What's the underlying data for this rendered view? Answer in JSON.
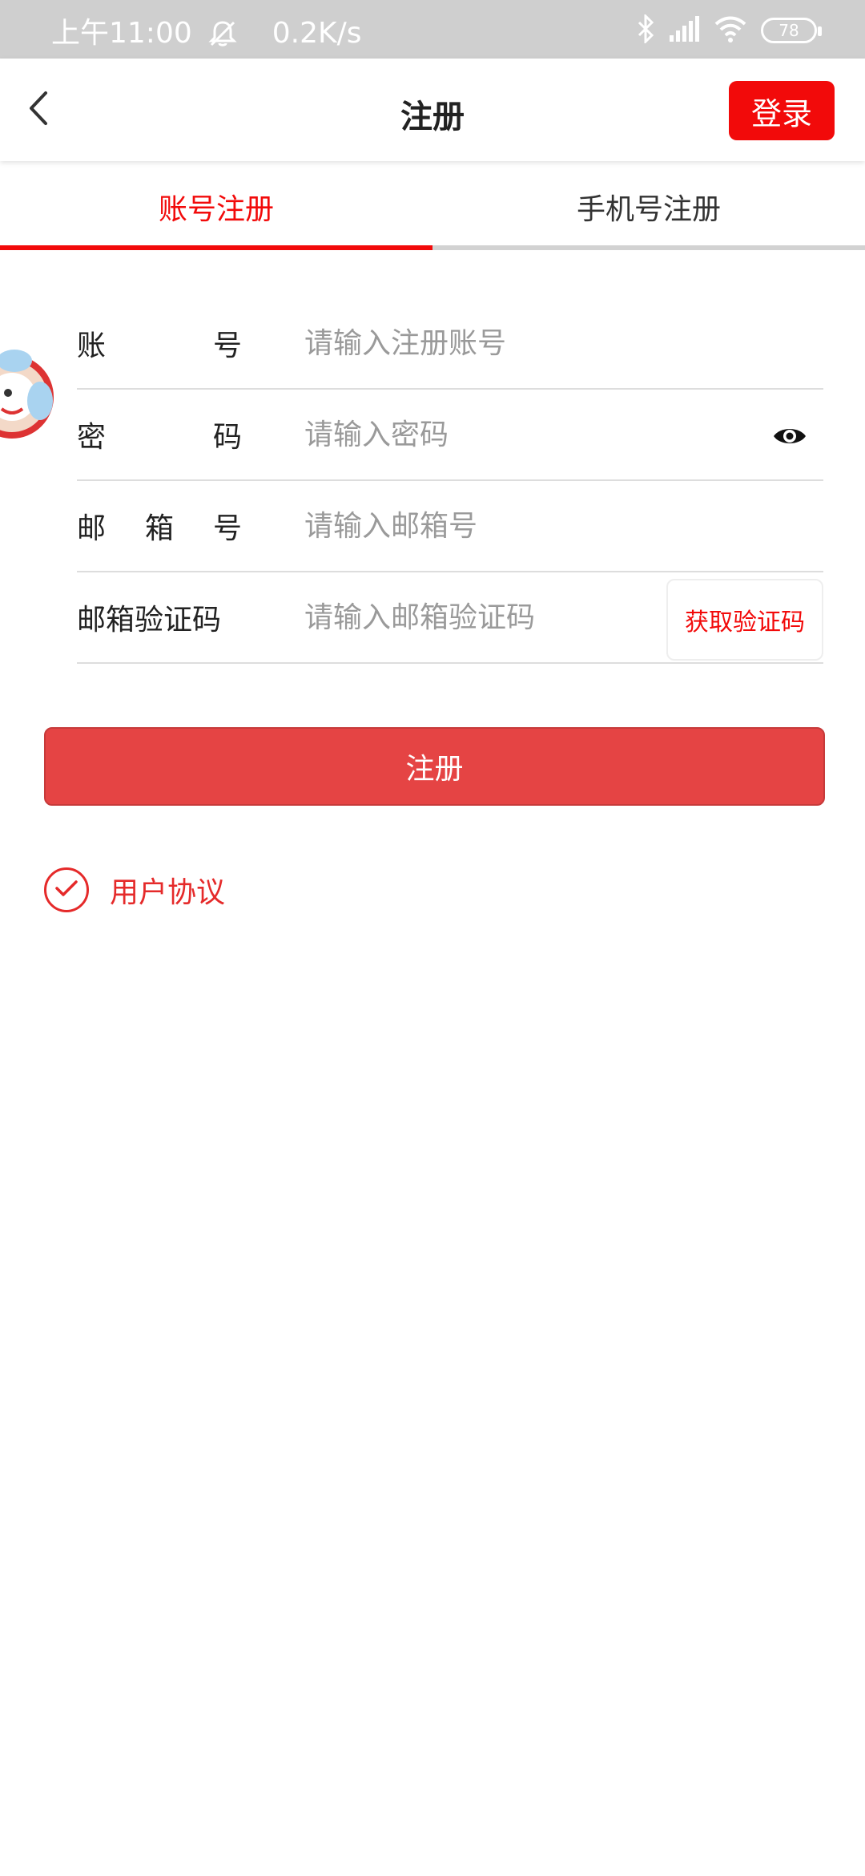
{
  "status_bar": {
    "time": "上午11:00",
    "net_speed": "0.2K/s",
    "battery": "78"
  },
  "header": {
    "title": "注册",
    "login_label": "登录"
  },
  "tabs": [
    {
      "label": "账号注册",
      "active": true
    },
    {
      "label": "手机号注册",
      "active": false
    }
  ],
  "form": {
    "account_label": [
      "账",
      "号"
    ],
    "account_placeholder": "请输入注册账号",
    "password_label": [
      "密",
      "码"
    ],
    "password_placeholder": "请输入密码",
    "email_label": [
      "邮",
      "箱",
      "号"
    ],
    "email_placeholder": "请输入邮箱号",
    "code_label": [
      "邮箱验证码"
    ],
    "code_placeholder": "请输入邮箱验证码",
    "get_code_label": "获取验证码"
  },
  "register_label": "注册",
  "agreement_label": "用户协议",
  "colors": {
    "accent": "#f20a0a",
    "button": "#e54444",
    "status_bar": "#cfcfcf"
  },
  "icons": [
    "back-icon",
    "bell-off-icon",
    "bluetooth-icon",
    "signal-icon",
    "wifi-icon",
    "battery-icon",
    "eye-icon",
    "check-icon",
    "mascot-icon"
  ]
}
